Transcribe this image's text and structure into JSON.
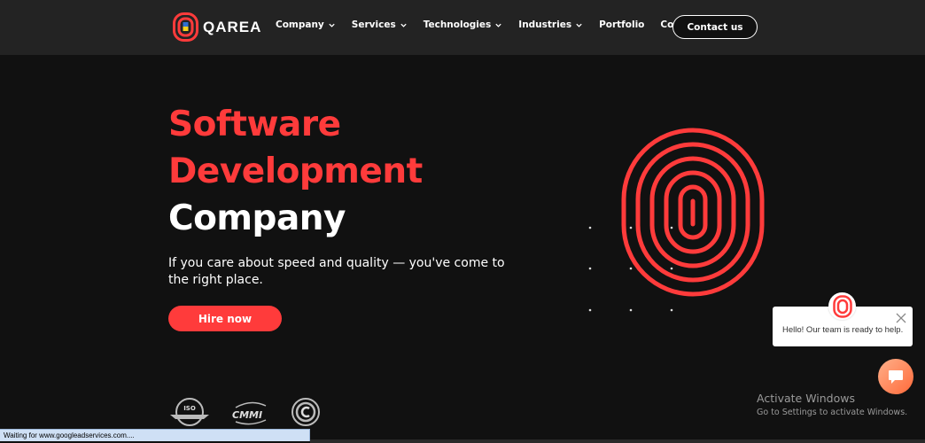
{
  "header": {
    "logo_text": "QAREA",
    "nav": [
      {
        "label": "Company",
        "has_dropdown": true
      },
      {
        "label": "Services",
        "has_dropdown": true
      },
      {
        "label": "Technologies",
        "has_dropdown": true
      },
      {
        "label": "Industries",
        "has_dropdown": true
      },
      {
        "label": "Portfolio",
        "has_dropdown": false
      },
      {
        "label": "Content",
        "has_dropdown": true
      }
    ],
    "contact_label": "Contact us"
  },
  "hero": {
    "title_line1": "Software",
    "title_line2": "Development",
    "title_line3": "Company",
    "subtitle": "If you care about speed and quality — you've come to the right place.",
    "cta_label": "Hire now"
  },
  "badges": {
    "iso_text": "ISO",
    "cmmi_text": "CMMI"
  },
  "chat": {
    "message": "Hello! Our team is ready to help."
  },
  "watermark": {
    "title": "Activate Windows",
    "subtitle": "Go to Settings to activate Windows."
  },
  "status_bar": {
    "text": "Waiting for www.googleadservices.com...."
  },
  "colors": {
    "accent": "#ff3b3b",
    "header_bg": "#232323",
    "page_bg": "#111111"
  }
}
